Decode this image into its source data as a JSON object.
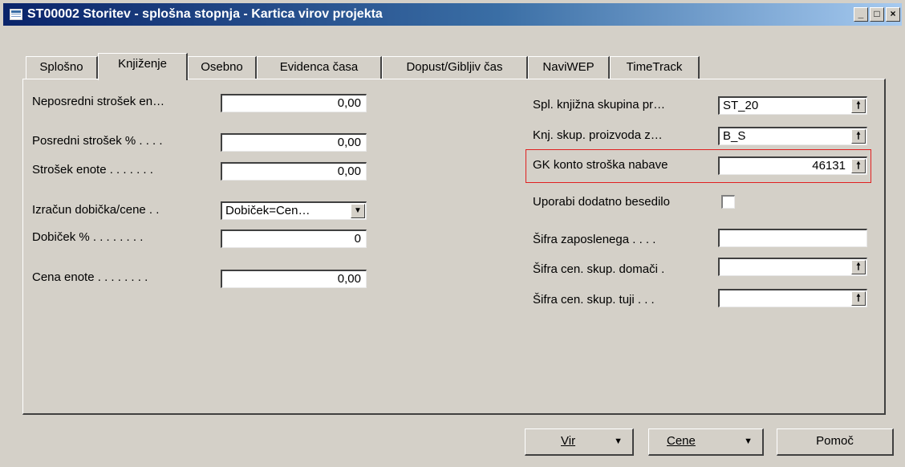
{
  "window": {
    "title": "ST00002 Storitev - splošna stopnja - Kartica virov projekta",
    "minimize": "_",
    "maximize": "□",
    "close": "×"
  },
  "tabs": [
    {
      "label": "Splošno"
    },
    {
      "label": "Knjiženje",
      "active": true
    },
    {
      "label": "Osebno"
    },
    {
      "label": "Evidenca časa"
    },
    {
      "label": "Dopust/Gibljiv čas"
    },
    {
      "label": "NaviWEP"
    },
    {
      "label": "TimeTrack"
    }
  ],
  "left": {
    "direct_cost": {
      "label": "Neposredni strošek en…",
      "value": "0,00"
    },
    "indirect_cost": {
      "label": "Posredni strošek % . . . .",
      "value": "0,00"
    },
    "unit_cost": {
      "label": "Strošek enote . . . . . . .",
      "value": "0,00"
    },
    "profit_calc": {
      "label": "Izračun dobička/cene . .",
      "value": "Dobiček=Cen…"
    },
    "profit_pct": {
      "label": "Dobiček % . . . . . . . .",
      "value": "0"
    },
    "unit_price": {
      "label": "Cena enote . . . . . . . .",
      "value": "0,00"
    }
  },
  "right": {
    "gen_prod_group": {
      "label": "Spl. knjižna skupina pr…",
      "value": "ST_20"
    },
    "prod_group": {
      "label": "Knj. skup. proizvoda z…",
      "value": "B_S"
    },
    "gl_account": {
      "label": "GK konto stroška nabave",
      "value": "46131"
    },
    "extended_text": {
      "label": "Uporabi dodatno besedilo"
    },
    "employee_no": {
      "label": "Šifra zaposlenega . . . .",
      "value": ""
    },
    "price_group_domestic": {
      "label": "Šifra cen. skup. domači .",
      "value": ""
    },
    "price_group_foreign": {
      "label": "Šifra cen. skup. tuji . . .",
      "value": ""
    }
  },
  "buttons": {
    "resource": {
      "label": "Vir"
    },
    "prices": {
      "label": "Cene"
    },
    "help": {
      "label": "Pomoč"
    }
  },
  "icons": {
    "lookup": "lookup-arrow-icon",
    "dropdown": "dropdown-arrow-icon"
  }
}
